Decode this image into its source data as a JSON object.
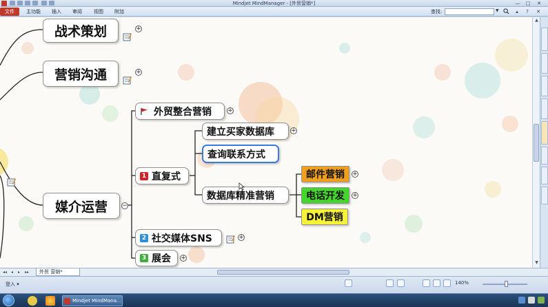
{
  "window": {
    "title": "Mindjet MindManager - [外贸营销*]",
    "controls": [
      "—",
      "□",
      "✕"
    ]
  },
  "menu": {
    "file": "文件",
    "items": [
      "主功能",
      "插入",
      "审阅",
      "视图",
      "附加"
    ],
    "search_label": "查找:",
    "search_value": ""
  },
  "map": {
    "main_topics": [
      "战术策划",
      "营销沟通",
      "媒介运营"
    ],
    "subtopics": [
      {
        "label": "外贸整合营销",
        "marker": "flag-red"
      },
      {
        "label": "直复式",
        "marker": "priority",
        "number": "1"
      },
      {
        "label": "社交媒体SNS",
        "marker": "priority",
        "number": "2"
      },
      {
        "label": "展会",
        "marker": "priority",
        "number": "3"
      }
    ],
    "direct_children": [
      "建立买家数据库",
      "查询联系方式",
      "数据库精准营销"
    ],
    "marketing_leaves": [
      {
        "label": "邮件营销",
        "color": "#f0a01e"
      },
      {
        "label": "电话开发",
        "color": "#44d62c"
      },
      {
        "label": "DM营销",
        "color": "#f6f23a"
      }
    ],
    "expand_symbol": "+",
    "collapse_symbol": "−"
  },
  "sheet": {
    "tab_label": "外贸 营销*",
    "nav": [
      "◂◂",
      "◂",
      "▸",
      "▸▸"
    ]
  },
  "status": {
    "left_text": "登入 ▾",
    "zoom": "140%"
  },
  "taskbar": {
    "task_label": "Mindjet MindMana..."
  },
  "colors": {
    "accent_red": "#c0392b",
    "priority_1": "#d0232a",
    "priority_2": "#2f8fd8",
    "priority_3": "#3fae3b",
    "selection": "#3b7bd8"
  }
}
